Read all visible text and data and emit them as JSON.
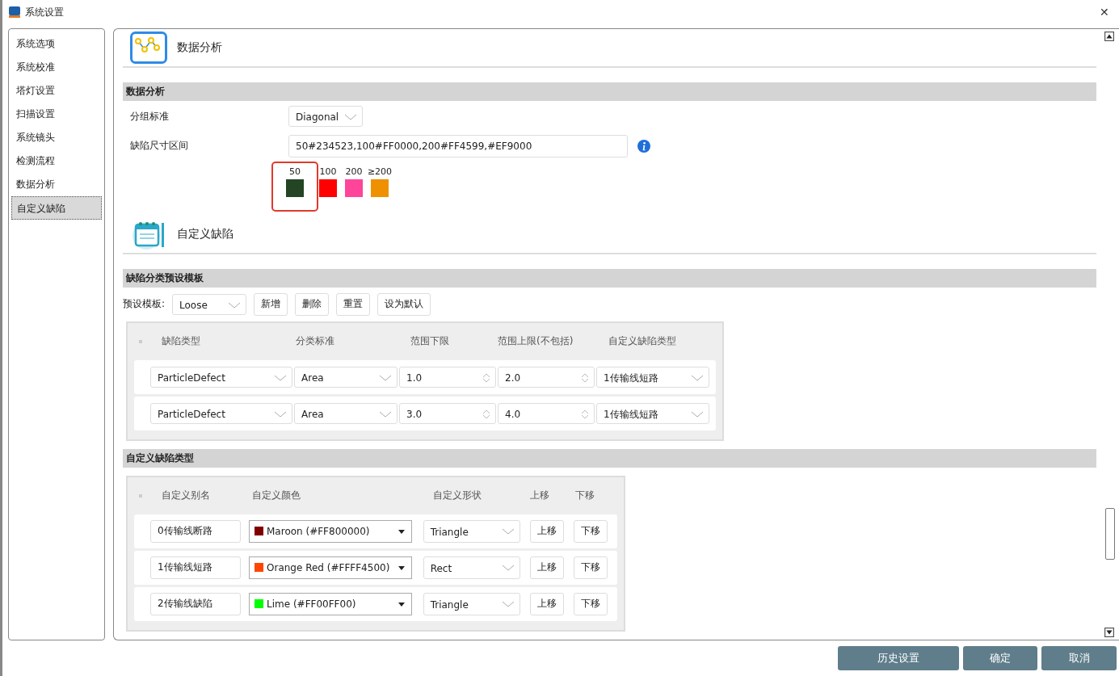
{
  "window": {
    "title": "系统设置",
    "close": "✕"
  },
  "sidebar": {
    "items": [
      {
        "label": "系统选项",
        "selected": false
      },
      {
        "label": "系统校准",
        "selected": false
      },
      {
        "label": "塔灯设置",
        "selected": false
      },
      {
        "label": "扫描设置",
        "selected": false
      },
      {
        "label": "系统镜头",
        "selected": false
      },
      {
        "label": "检测流程",
        "selected": false
      },
      {
        "label": "数据分析",
        "selected": false
      },
      {
        "label": "自定义缺陷",
        "selected": true
      }
    ]
  },
  "analysis": {
    "heading": "数据分析",
    "section": "数据分析",
    "group_label": "分组标准",
    "group_value": "Diagonal",
    "range_label": "缺陷尺寸区间",
    "range_value": "50#234523,100#FF0000,200#FF4599,#EF9000",
    "legend": [
      {
        "label": "50",
        "color": "#234523",
        "highlighted": true
      },
      {
        "label": "100",
        "color": "#ff0000",
        "highlighted": false
      },
      {
        "label": "200",
        "color": "#ff4599",
        "highlighted": false
      },
      {
        "label": "≥200",
        "color": "#ef9000",
        "highlighted": false
      }
    ]
  },
  "custom": {
    "heading": "自定义缺陷",
    "section": "缺陷分类预设模板",
    "preset_label": "预设模板:",
    "preset_value": "Loose",
    "buttons": [
      "新增",
      "删除",
      "重置",
      "设为默认"
    ],
    "template_table": {
      "columns": [
        "缺陷类型",
        "分类标准",
        "范围下限",
        "范围上限(不包括)",
        "自定义缺陷类型"
      ],
      "rows": [
        {
          "type": "ParticleDefect",
          "criterion": "Area",
          "min": "1.0",
          "max": "2.0",
          "custom_type": "1传输线短路"
        },
        {
          "type": "ParticleDefect",
          "criterion": "Area",
          "min": "3.0",
          "max": "4.0",
          "custom_type": "1传输线短路"
        }
      ]
    },
    "types_section": "自定义缺陷类型",
    "types_table": {
      "columns": [
        "自定义别名",
        "自定义颜色",
        "自定义形状",
        "上移",
        "下移"
      ],
      "rows": [
        {
          "alias": "0传输线断路",
          "color_name": "Maroon (#FF800000)",
          "color": "#800000",
          "shape": "Triangle",
          "up": "上移",
          "down": "下移"
        },
        {
          "alias": "1传输线短路",
          "color_name": "Orange Red (#FFFF4500)",
          "color": "#ff4500",
          "shape": "Rect",
          "up": "上移",
          "down": "下移"
        },
        {
          "alias": "2传输线缺陷",
          "color_name": "Lime (#FF00FF00)",
          "color": "#00ff00",
          "shape": "Triangle",
          "up": "上移",
          "down": "下移"
        }
      ]
    }
  },
  "footer": {
    "buttons": [
      "历史设置",
      "确定",
      "取消"
    ]
  }
}
